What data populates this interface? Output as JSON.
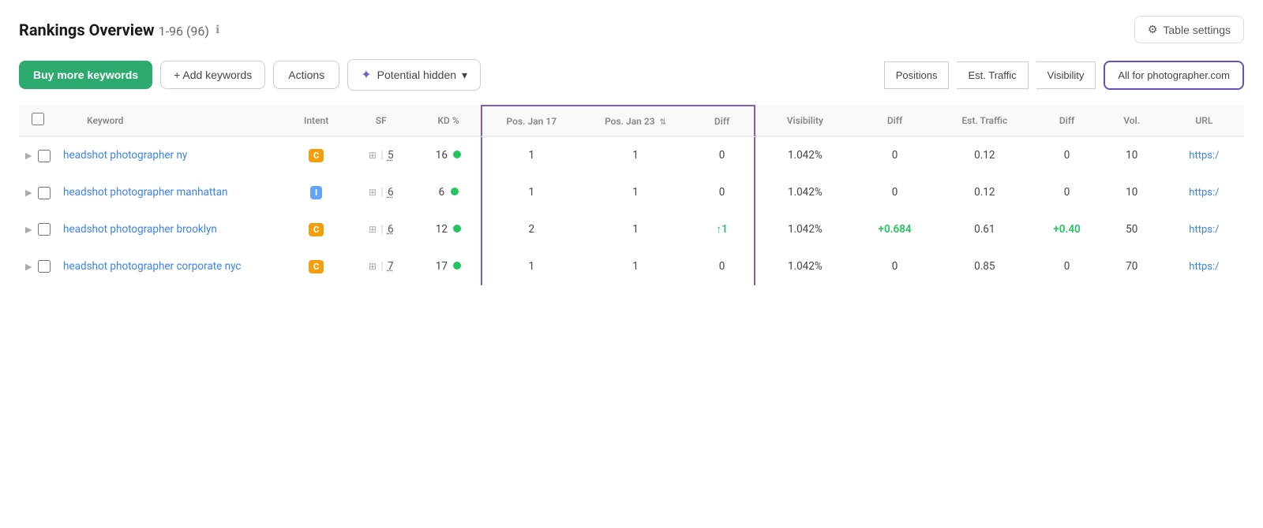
{
  "header": {
    "title": "Rankings Overview",
    "range": "1-96 (96)",
    "info_icon": "ℹ",
    "table_settings_label": "Table settings",
    "gear_icon": "⚙"
  },
  "toolbar": {
    "buy_label": "Buy more keywords",
    "add_label": "+ Add keywords",
    "actions_label": "Actions",
    "potential_label": "Potential hidden",
    "positions_label": "Positions",
    "est_traffic_label": "Est. Traffic",
    "visibility_label": "Visibility",
    "domain_label": "All for photographer.com"
  },
  "table": {
    "columns": {
      "keyword": "Keyword",
      "intent": "Intent",
      "sf": "SF",
      "kd": "KD %",
      "pos_jan17": "Pos. Jan 17",
      "pos_jan23": "Pos. Jan 23",
      "diff1": "Diff",
      "visibility": "Visibility",
      "vis_diff": "Diff",
      "est_traffic": "Est. Traffic",
      "est_diff": "Diff",
      "vol": "Vol.",
      "url": "URL"
    },
    "rows": [
      {
        "keyword": "headshot photographer ny",
        "keyword_url": "https:/",
        "intent": "C",
        "intent_type": "c",
        "sf_num": "5",
        "kd": "16",
        "kd_dot": true,
        "pos_jan17": "1",
        "pos_jan23": "1",
        "diff1": "0",
        "diff1_type": "neutral",
        "visibility": "1.042%",
        "vis_diff": "0",
        "vis_diff_type": "neutral",
        "est_traffic": "0.12",
        "est_diff": "0",
        "est_diff_type": "neutral",
        "vol": "10",
        "url": "https:/"
      },
      {
        "keyword": "headshot photographer manhattan",
        "keyword_url": "https:/",
        "intent": "I",
        "intent_type": "i",
        "sf_num": "6",
        "kd": "6",
        "kd_dot": true,
        "pos_jan17": "1",
        "pos_jan23": "1",
        "diff1": "0",
        "diff1_type": "neutral",
        "visibility": "1.042%",
        "vis_diff": "0",
        "vis_diff_type": "neutral",
        "est_traffic": "0.12",
        "est_diff": "0",
        "est_diff_type": "neutral",
        "vol": "10",
        "url": "https:/"
      },
      {
        "keyword": "headshot photographer brooklyn",
        "keyword_url": "https:/",
        "intent": "C",
        "intent_type": "c",
        "sf_num": "6",
        "kd": "12",
        "kd_dot": true,
        "pos_jan17": "2",
        "pos_jan23": "1",
        "diff1": "↑1",
        "diff1_type": "up",
        "visibility": "1.042%",
        "vis_diff": "+0.684",
        "vis_diff_type": "positive",
        "est_traffic": "0.61",
        "est_diff": "+0.40",
        "est_diff_type": "positive",
        "vol": "50",
        "url": "https:/"
      },
      {
        "keyword": "headshot photographer corporate nyc",
        "keyword_url": "https:/",
        "intent": "C",
        "intent_type": "c",
        "sf_num": "7",
        "kd": "17",
        "kd_dot": true,
        "pos_jan17": "1",
        "pos_jan23": "1",
        "diff1": "0",
        "diff1_type": "neutral",
        "visibility": "1.042%",
        "vis_diff": "0",
        "vis_diff_type": "neutral",
        "est_traffic": "0.85",
        "est_diff": "0",
        "est_diff_type": "neutral",
        "vol": "70",
        "url": "https:/"
      }
    ]
  },
  "highlight": {
    "border_color": "#7c5cbf"
  }
}
